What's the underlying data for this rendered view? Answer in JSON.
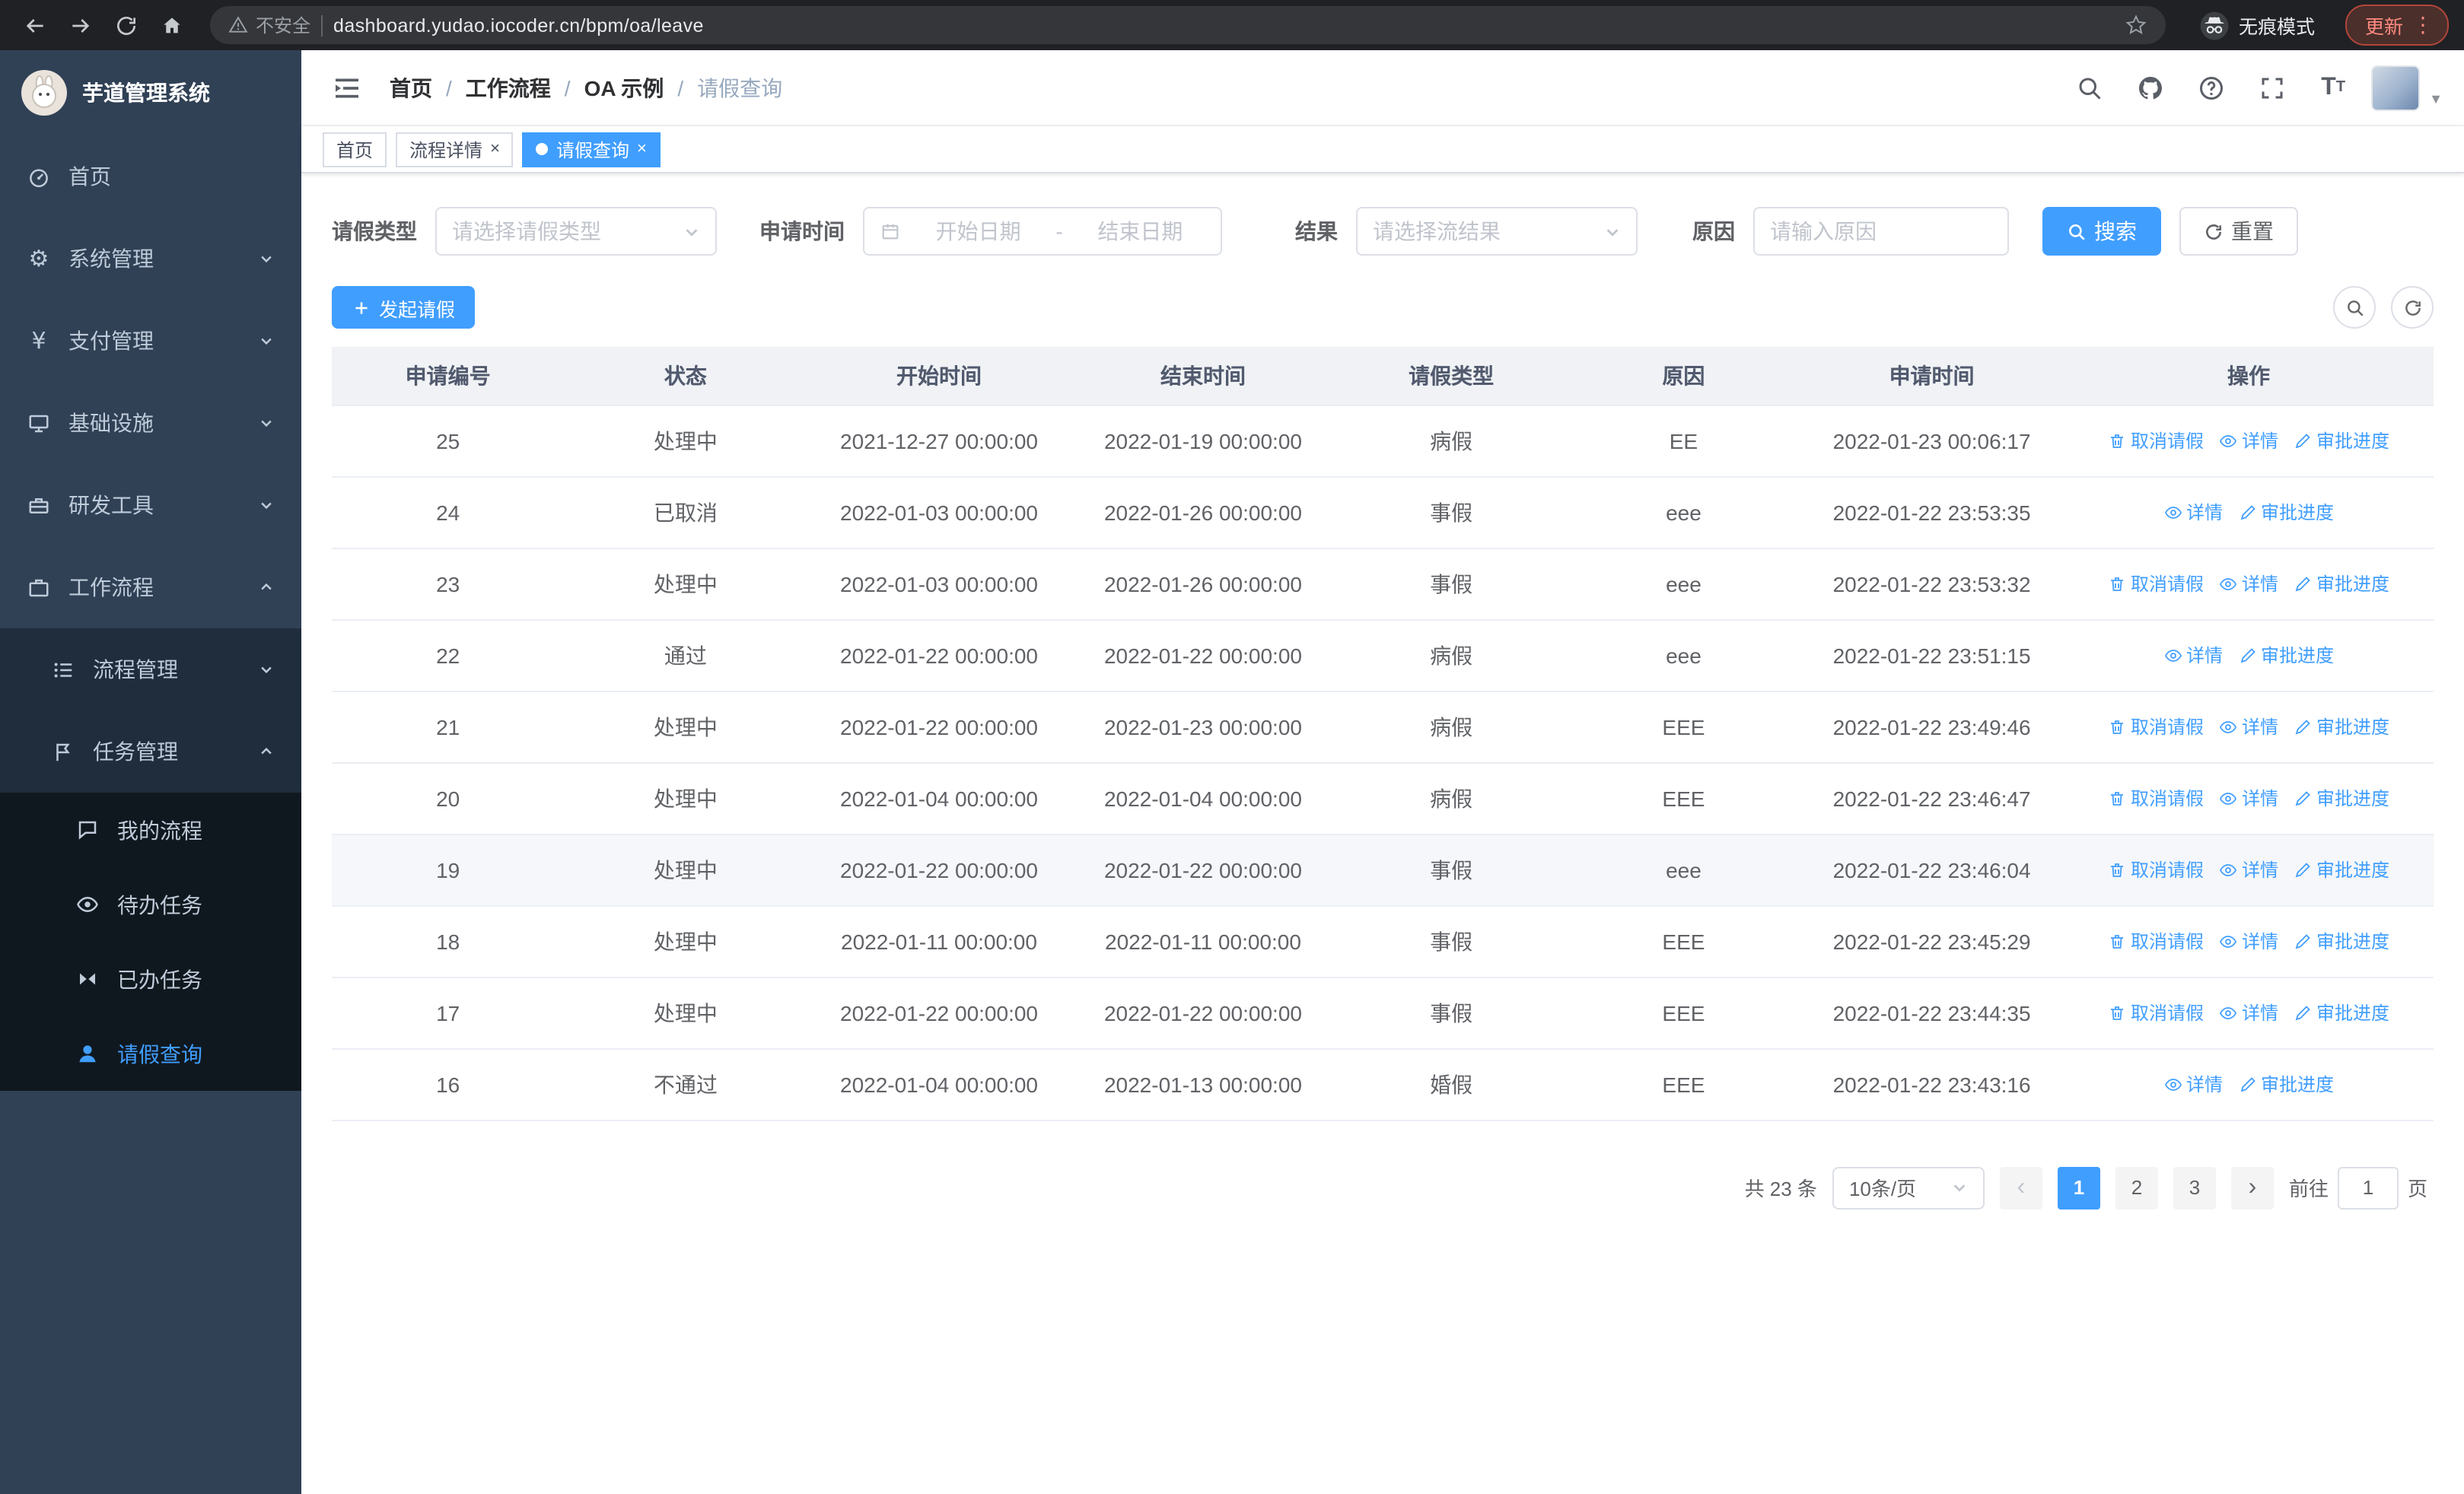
{
  "browser": {
    "security_label": "不安全",
    "url": "dashboard.yudao.iocoder.cn/bpm/oa/leave",
    "incognito_label": "无痕模式",
    "update_label": "更新",
    "kebab": "⋮"
  },
  "sidebar": {
    "logo_title": "芋道管理系统",
    "items": [
      {
        "label": "首页"
      },
      {
        "label": "系统管理"
      },
      {
        "label": "支付管理"
      },
      {
        "label": "基础设施"
      },
      {
        "label": "研发工具"
      },
      {
        "label": "工作流程"
      },
      {
        "label": "流程管理"
      },
      {
        "label": "任务管理"
      },
      {
        "label": "我的流程"
      },
      {
        "label": "待办任务"
      },
      {
        "label": "已办任务"
      },
      {
        "label": "请假查询"
      }
    ]
  },
  "header": {
    "breadcrumb": [
      "首页",
      "工作流程",
      "OA 示例",
      "请假查询"
    ],
    "separator": "/"
  },
  "tabs": {
    "items": [
      {
        "label": "首页"
      },
      {
        "label": "流程详情"
      },
      {
        "label": "请假查询"
      }
    ],
    "close_glyph": "×"
  },
  "filters": {
    "leave_type_label": "请假类型",
    "leave_type_placeholder": "请选择请假类型",
    "apply_time_label": "申请时间",
    "start_date_placeholder": "开始日期",
    "range_separator": "-",
    "end_date_placeholder": "结束日期",
    "result_label": "结果",
    "result_placeholder": "请选择流结果",
    "reason_label": "原因",
    "reason_placeholder": "请输入原因",
    "search_label": "搜索",
    "reset_label": "重置"
  },
  "toolbar": {
    "create_label": "发起请假"
  },
  "table": {
    "columns": [
      "申请编号",
      "状态",
      "开始时间",
      "结束时间",
      "请假类型",
      "原因",
      "申请时间",
      "操作"
    ],
    "action_labels": {
      "cancel": "取消请假",
      "detail": "详情",
      "progress": "审批进度"
    },
    "rows": [
      {
        "id": "25",
        "status": "处理中",
        "start": "2021-12-27 00:00:00",
        "end": "2022-01-19 00:00:00",
        "type": "病假",
        "reason": "EE",
        "applied": "2022-01-23 00:06:17",
        "actions": [
          "cancel",
          "detail",
          "progress"
        ],
        "highlight": false
      },
      {
        "id": "24",
        "status": "已取消",
        "start": "2022-01-03 00:00:00",
        "end": "2022-01-26 00:00:00",
        "type": "事假",
        "reason": "eee",
        "applied": "2022-01-22 23:53:35",
        "actions": [
          "detail",
          "progress"
        ],
        "highlight": false
      },
      {
        "id": "23",
        "status": "处理中",
        "start": "2022-01-03 00:00:00",
        "end": "2022-01-26 00:00:00",
        "type": "事假",
        "reason": "eee",
        "applied": "2022-01-22 23:53:32",
        "actions": [
          "cancel",
          "detail",
          "progress"
        ],
        "highlight": false
      },
      {
        "id": "22",
        "status": "通过",
        "start": "2022-01-22 00:00:00",
        "end": "2022-01-22 00:00:00",
        "type": "病假",
        "reason": "eee",
        "applied": "2022-01-22 23:51:15",
        "actions": [
          "detail",
          "progress"
        ],
        "highlight": false
      },
      {
        "id": "21",
        "status": "处理中",
        "start": "2022-01-22 00:00:00",
        "end": "2022-01-23 00:00:00",
        "type": "病假",
        "reason": "EEE",
        "applied": "2022-01-22 23:49:46",
        "actions": [
          "cancel",
          "detail",
          "progress"
        ],
        "highlight": false
      },
      {
        "id": "20",
        "status": "处理中",
        "start": "2022-01-04 00:00:00",
        "end": "2022-01-04 00:00:00",
        "type": "病假",
        "reason": "EEE",
        "applied": "2022-01-22 23:46:47",
        "actions": [
          "cancel",
          "detail",
          "progress"
        ],
        "highlight": false
      },
      {
        "id": "19",
        "status": "处理中",
        "start": "2022-01-22 00:00:00",
        "end": "2022-01-22 00:00:00",
        "type": "事假",
        "reason": "eee",
        "applied": "2022-01-22 23:46:04",
        "actions": [
          "cancel",
          "detail",
          "progress"
        ],
        "highlight": true
      },
      {
        "id": "18",
        "status": "处理中",
        "start": "2022-01-11 00:00:00",
        "end": "2022-01-11 00:00:00",
        "type": "事假",
        "reason": "EEE",
        "applied": "2022-01-22 23:45:29",
        "actions": [
          "cancel",
          "detail",
          "progress"
        ],
        "highlight": false
      },
      {
        "id": "17",
        "status": "处理中",
        "start": "2022-01-22 00:00:00",
        "end": "2022-01-22 00:00:00",
        "type": "事假",
        "reason": "EEE",
        "applied": "2022-01-22 23:44:35",
        "actions": [
          "cancel",
          "detail",
          "progress"
        ],
        "highlight": false
      },
      {
        "id": "16",
        "status": "不通过",
        "start": "2022-01-04 00:00:00",
        "end": "2022-01-13 00:00:00",
        "type": "婚假",
        "reason": "EEE",
        "applied": "2022-01-22 23:43:16",
        "actions": [
          "detail",
          "progress"
        ],
        "highlight": false
      }
    ]
  },
  "pagination": {
    "total_label": "共 23 条",
    "page_size": "10条/页",
    "pages": [
      "1",
      "2",
      "3"
    ],
    "active_page": "1",
    "prev_glyph": "‹",
    "next_glyph": "›",
    "goto_prefix": "前往",
    "goto_value": "1",
    "goto_suffix": "页"
  },
  "colors": {
    "primary": "#409eff",
    "sidebar_bg": "#304156",
    "sidebar_sub_bg": "#1f2d3d",
    "sidebar_deep_bg": "#10181f",
    "chrome_bg": "#202124"
  }
}
